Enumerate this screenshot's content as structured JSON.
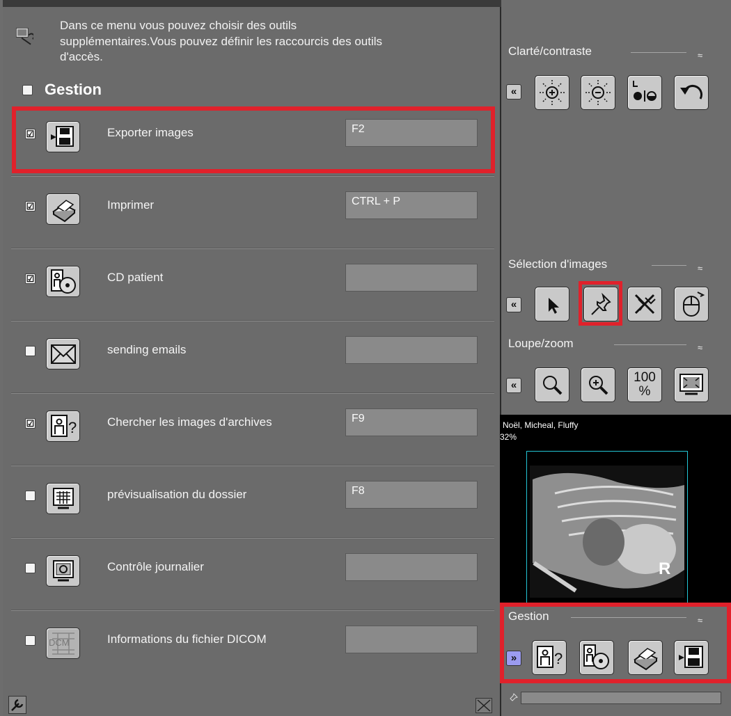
{
  "panel": {
    "intro_line1": "Dans ce menu vous pouvez choisir des outils",
    "intro_line2": "supplémentaires.Vous pouvez définir les raccourcis des outils",
    "intro_line3": "d'accès.",
    "section_title": "Gestion",
    "tools": [
      {
        "label": "Exporter images",
        "shortcut": "F2",
        "checked": true,
        "icon": "export-images-icon"
      },
      {
        "label": "Imprimer",
        "shortcut": "CTRL + P",
        "checked": true,
        "icon": "printer-icon"
      },
      {
        "label": "CD patient",
        "shortcut": "",
        "checked": true,
        "icon": "patient-cd-icon"
      },
      {
        "label": "sending emails",
        "shortcut": "",
        "checked": false,
        "icon": "envelope-icon"
      },
      {
        "label": "Chercher les images d'archives",
        "shortcut": "F9",
        "checked": true,
        "icon": "archive-search-icon"
      },
      {
        "label": "prévisualisation du dossier",
        "shortcut": "F8",
        "checked": false,
        "icon": "folder-preview-icon"
      },
      {
        "label": "Contrôle journalier",
        "shortcut": "",
        "checked": false,
        "icon": "daily-check-icon"
      },
      {
        "label": "Informations du fichier DICOM",
        "shortcut": "",
        "checked": false,
        "icon": "dicom-info-icon"
      }
    ],
    "dicom_icon_text": "DCM",
    "check_mark": "☑"
  },
  "right": {
    "groups": [
      {
        "title": "Clarté/contraste",
        "collapse": "≈"
      },
      {
        "title": "Sélection d'images",
        "collapse": "≈"
      },
      {
        "title": "Loupe/zoom",
        "collapse": "≈"
      },
      {
        "title": "Gestion",
        "collapse": "≈"
      }
    ],
    "expand_label": "«",
    "expand_gestion_label": "»",
    "zoom_100_label_top": "100",
    "zoom_100_label_bottom": "%",
    "viewer": {
      "patient": "Noël, Micheal, Fluffy",
      "zoom": "32%",
      "marker": "R"
    }
  },
  "colors": {
    "highlight": "#e0212b",
    "accent_expand": "#9b9bf0",
    "xray_frame": "#23c6d6"
  }
}
